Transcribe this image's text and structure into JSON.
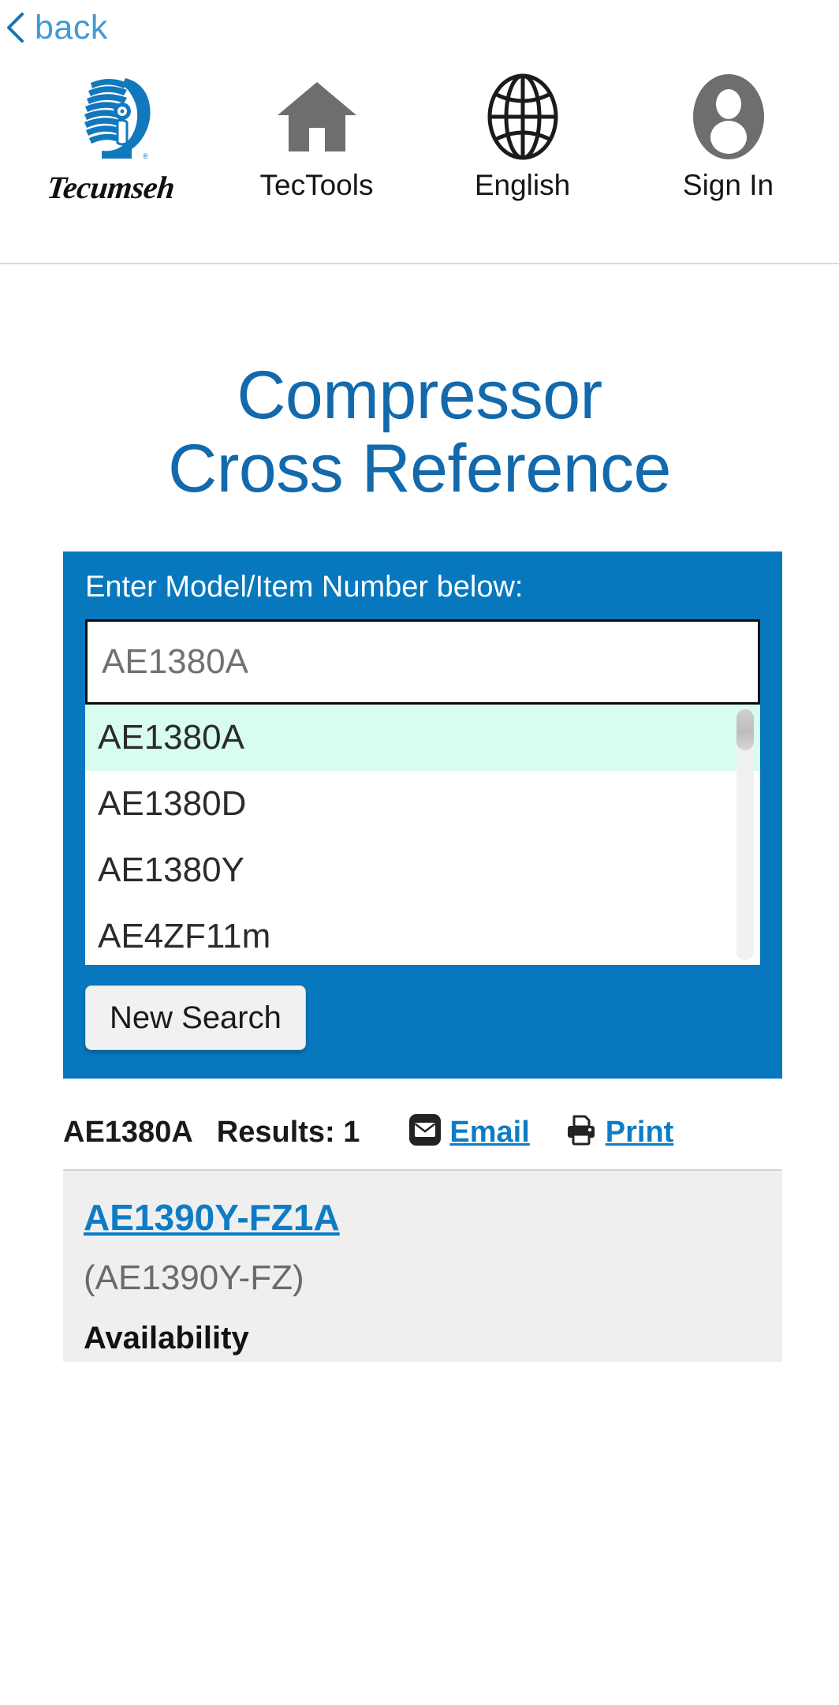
{
  "back": {
    "label": "back",
    "icon": "chevron-left-icon"
  },
  "header": {
    "items": [
      {
        "label": "Tecumseh",
        "icon": "tecumseh-logo-icon"
      },
      {
        "label": "TecTools",
        "icon": "home-icon"
      },
      {
        "label": "English",
        "icon": "globe-icon"
      },
      {
        "label": "Sign In",
        "icon": "user-account-icon"
      }
    ]
  },
  "title": {
    "line1": "Compressor",
    "line2": "Cross Reference"
  },
  "search": {
    "label": "Enter Model/Item Number below:",
    "input_value": "AE1380A",
    "placeholder": "Enter Model/Item Number",
    "suggestions": [
      {
        "label": "AE1380A",
        "active": true
      },
      {
        "label": "AE1380D",
        "active": false
      },
      {
        "label": "AE1380Y",
        "active": false
      },
      {
        "label": "AE4ZF11m",
        "active": false
      }
    ],
    "new_search_label": "New Search"
  },
  "results": {
    "term": "AE1380A",
    "count_label": "Results: 1",
    "email_label": "Email",
    "print_label": "Print",
    "items": [
      {
        "model": "AE1390Y-FZ1A",
        "alt_model": "(AE1390Y-FZ)",
        "field_label": "Availability"
      }
    ]
  },
  "colors": {
    "brand_blue": "#0778be",
    "title_blue": "#1269ac",
    "link_blue": "#0d7cc4",
    "back_blue": "#3f9ad8",
    "suggest_active": "#d8fdf0",
    "card_gray": "#efefef"
  }
}
